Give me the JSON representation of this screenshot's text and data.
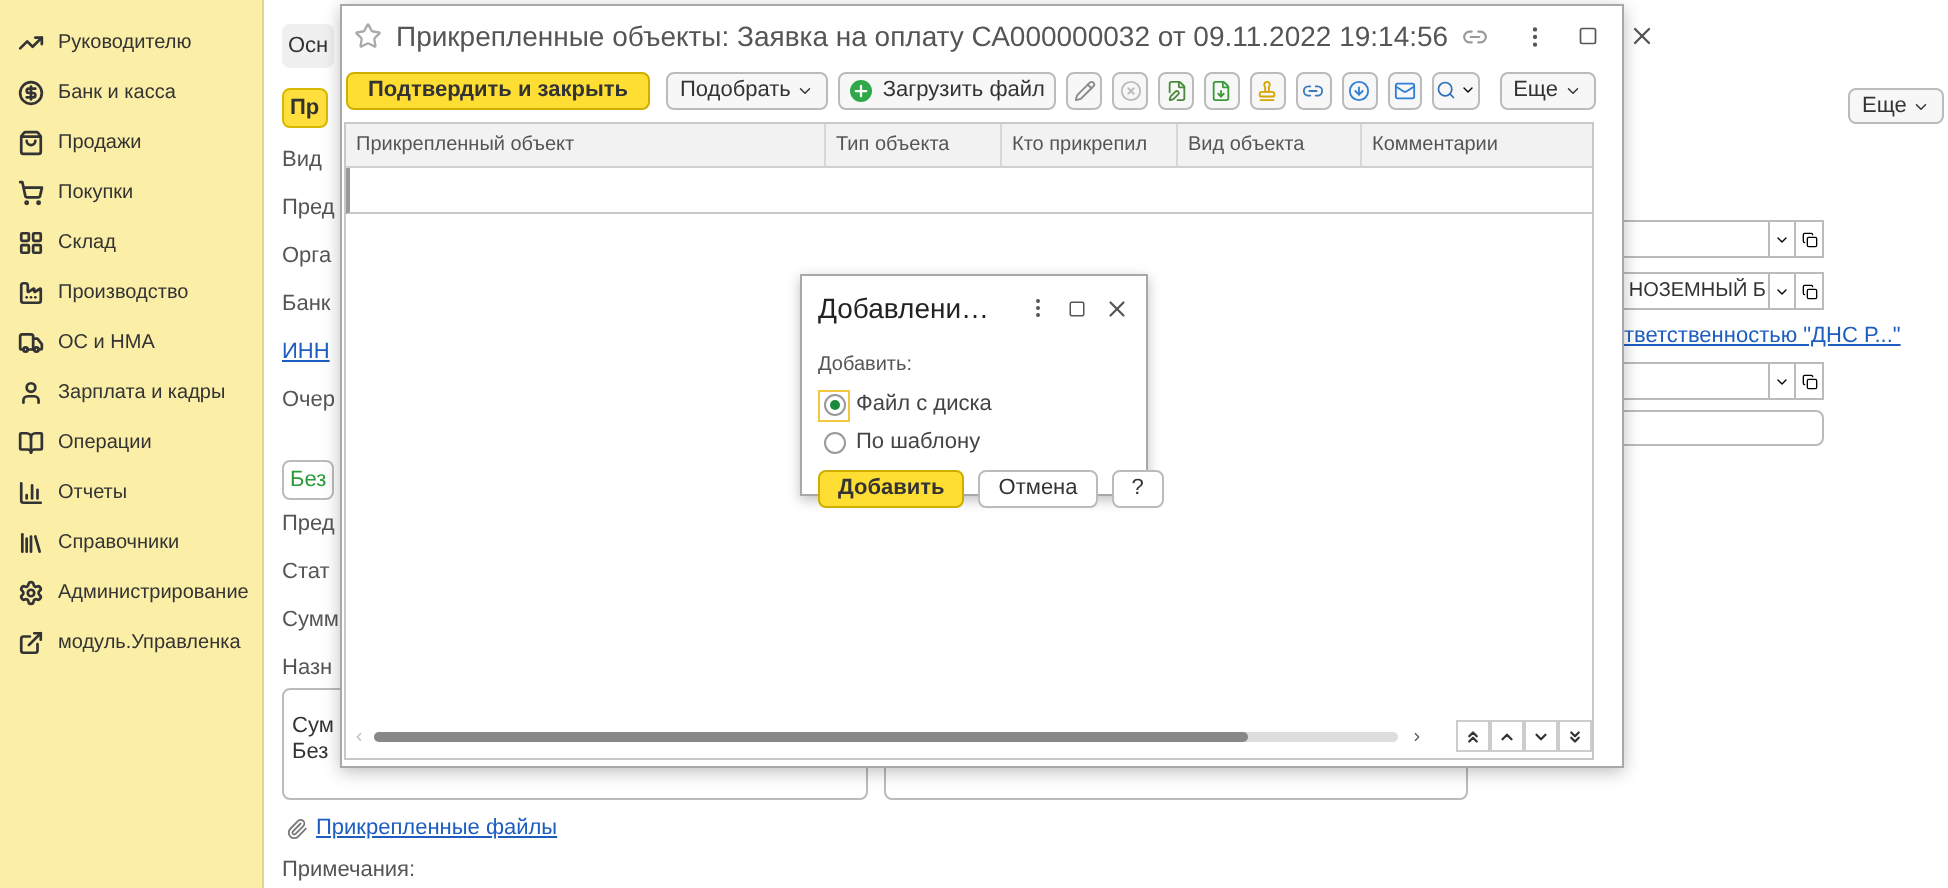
{
  "sidebar": {
    "items": [
      {
        "label": "Руководителю",
        "kind": "trend"
      },
      {
        "label": "Банк и касса",
        "kind": "coin"
      },
      {
        "label": "Продажи",
        "kind": "bag"
      },
      {
        "label": "Покупки",
        "kind": "cart"
      },
      {
        "label": "Склад",
        "kind": "warehouse"
      },
      {
        "label": "Производство",
        "kind": "factory"
      },
      {
        "label": "ОС и НМА",
        "kind": "truck"
      },
      {
        "label": "Зарплата и кадры",
        "kind": "person"
      },
      {
        "label": "Операции",
        "kind": "ledger"
      },
      {
        "label": "Отчеты",
        "kind": "chart"
      },
      {
        "label": "Справочники",
        "kind": "books"
      },
      {
        "label": "Администрирование",
        "kind": "gear"
      },
      {
        "label": "модуль.Управленка",
        "kind": "external"
      }
    ]
  },
  "document_form": {
    "tab": "Осн",
    "primary_button": "Пр",
    "labels_top": [
      "Вид",
      "Пред",
      "Орга",
      "Банк"
    ],
    "tax_link": "ИНН",
    "queue_label": "Очер",
    "status_button": "Без",
    "labels_bottom": [
      "Пред",
      "Стат",
      "Сумм",
      "Назн"
    ],
    "purpose_text": [
      "Сум",
      "Без"
    ],
    "attachments_link": "Прикрепленные файлы",
    "notes_label": "Примечания:",
    "more_button": "Еще",
    "bank_field": "НОЗЕМНЫЙ Б",
    "organization_link": "тветственностью \"ДНС Р...\""
  },
  "attached_objects_window": {
    "title": "Прикрепленные объекты: Заявка на оплату СА000000032 от 09.11.2022 19:14:56",
    "toolbar": {
      "confirm": "Подтвердить и закрыть",
      "pick": "Подобрать",
      "upload": "Загрузить файл",
      "more": "Еще"
    },
    "columns": [
      "Прикрепленный объект",
      "Тип объекта",
      "Кто прикрепил",
      "Вид объекта",
      "Комментарии"
    ]
  },
  "add_dialog": {
    "title": "Добавлени…",
    "label": "Добавить:",
    "options": [
      {
        "label": "Файл с диска",
        "selected": true
      },
      {
        "label": "По шаблону",
        "selected": false
      }
    ],
    "buttons": [
      {
        "label": "Добавить",
        "kind": "default"
      },
      {
        "label": "Отмена",
        "kind": "normal"
      },
      {
        "label": "?",
        "kind": "normal"
      }
    ]
  }
}
